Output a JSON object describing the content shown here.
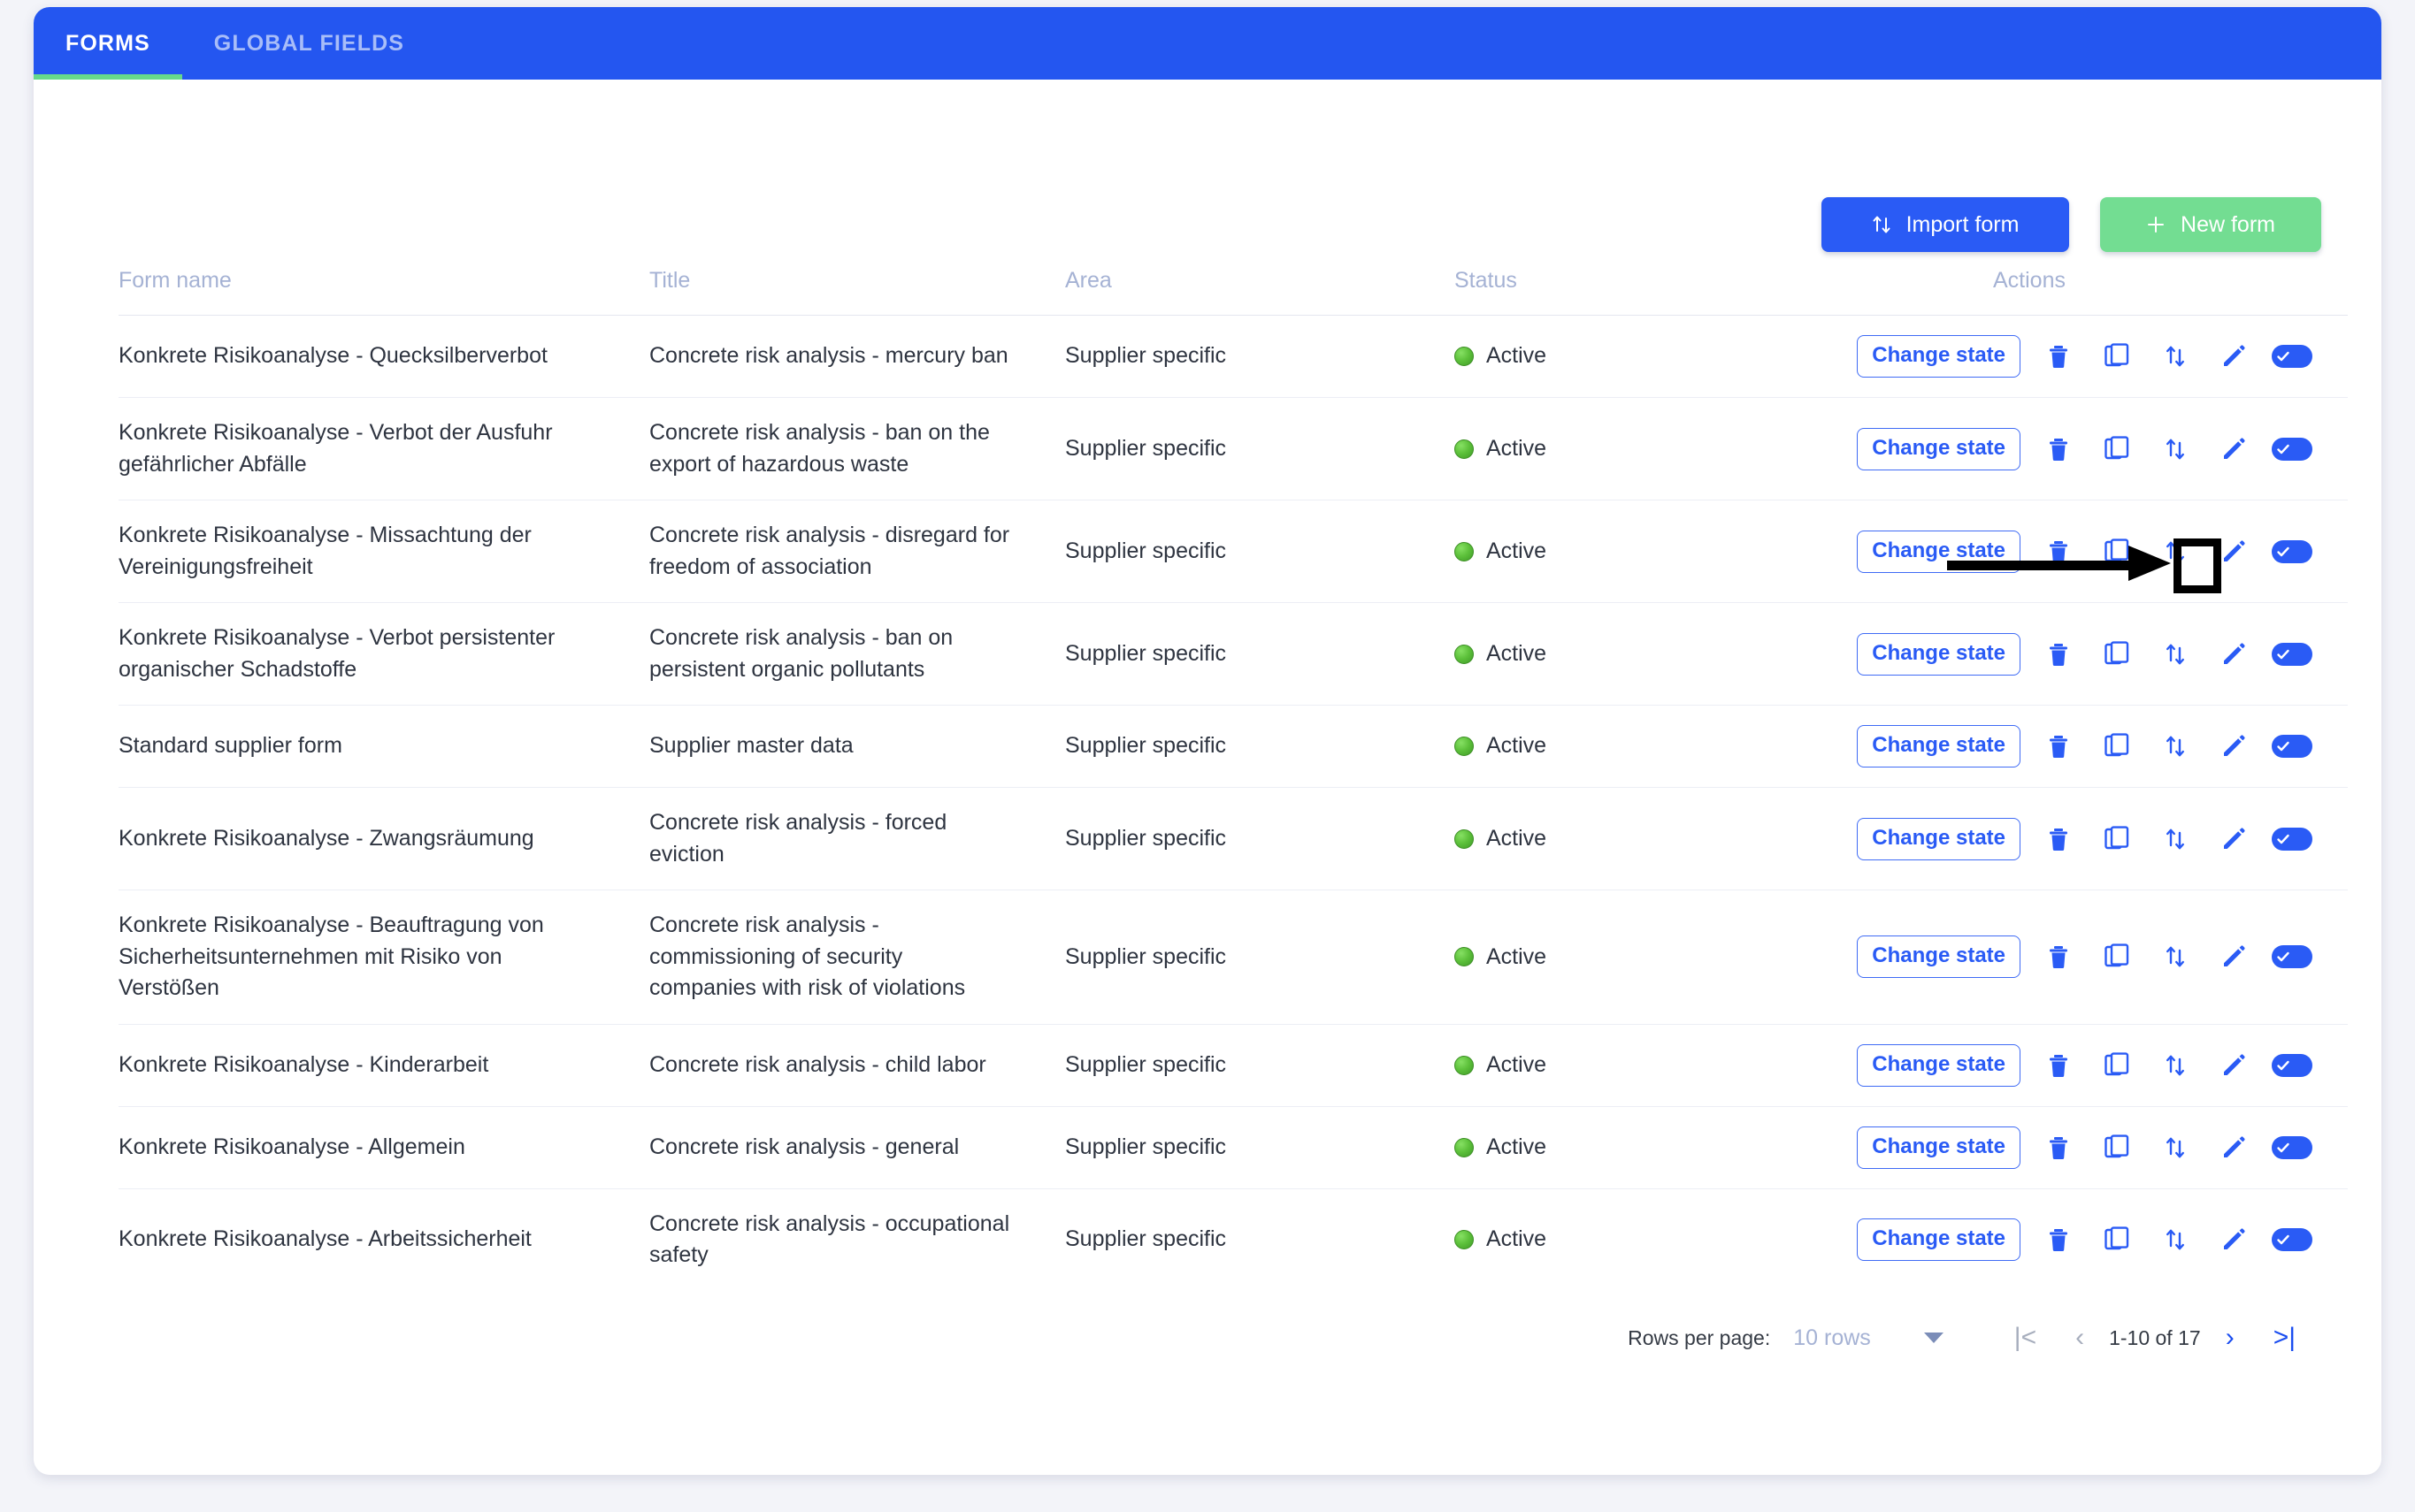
{
  "tabs": [
    {
      "label": "FORMS",
      "active": true
    },
    {
      "label": "GLOBAL FIELDS",
      "active": false
    }
  ],
  "toolbar": {
    "import_label": "Import form",
    "import_icon": "import-export-arrows-icon",
    "new_label": "New form",
    "new_icon": "plus-icon"
  },
  "table": {
    "headers": {
      "name": "Form name",
      "title": "Title",
      "area": "Area",
      "status": "Status",
      "actions": "Actions"
    },
    "row_action_labels": {
      "change_state": "Change state",
      "delete": "delete-icon",
      "duplicate": "copy-icon",
      "export": "import-export-arrows-icon",
      "edit": "pencil-icon",
      "toggle": "toggle-on-icon"
    },
    "rows": [
      {
        "name": "Konkrete Risikoanalyse - Quecksilberverbot",
        "title": "Concrete risk analysis - mercury ban",
        "area": "Supplier specific",
        "status": "Active"
      },
      {
        "name": "Konkrete Risikoanalyse - Verbot der Ausfuhr gefährlicher Abfälle",
        "title": "Concrete risk analysis - ban on the export of hazardous waste",
        "area": "Supplier specific",
        "status": "Active"
      },
      {
        "name": "Konkrete Risikoanalyse - Missachtung der Vereinigungsfreiheit",
        "title": "Concrete risk analysis - disregard for freedom of association",
        "area": "Supplier specific",
        "status": "Active"
      },
      {
        "name": "Konkrete Risikoanalyse - Verbot persistenter organischer Schadstoffe",
        "title": "Concrete risk analysis - ban on persistent organic pollutants",
        "area": "Supplier specific",
        "status": "Active"
      },
      {
        "name": "Standard supplier form",
        "title": "Supplier master data",
        "area": "Supplier specific",
        "status": "Active"
      },
      {
        "name": "Konkrete Risikoanalyse - Zwangsräumung",
        "title": "Concrete risk analysis - forced eviction",
        "area": "Supplier specific",
        "status": "Active"
      },
      {
        "name": "Konkrete Risikoanalyse - Beauftragung von Sicherheitsunternehmen mit Risiko von Verstößen",
        "title": "Concrete risk analysis - commissioning of security companies with risk of violations",
        "area": "Supplier specific",
        "status": "Active"
      },
      {
        "name": "Konkrete Risikoanalyse - Kinderarbeit",
        "title": "Concrete risk analysis - child labor",
        "area": "Supplier specific",
        "status": "Active"
      },
      {
        "name": "Konkrete Risikoanalyse - Allgemein",
        "title": "Concrete risk analysis - general",
        "area": "Supplier specific",
        "status": "Active"
      },
      {
        "name": "Konkrete Risikoanalyse - Arbeitssicherheit",
        "title": "Concrete risk analysis - occupational safety",
        "area": "Supplier specific",
        "status": "Active"
      }
    ]
  },
  "pagination": {
    "rows_per_page_label": "Rows per page:",
    "rows_per_page_value": "10 rows",
    "range": "1-10 of 17",
    "first_icon": "|<",
    "prev_icon": "‹",
    "next_icon": "›",
    "last_icon": ">|"
  },
  "annotation": {
    "target": "export-icon-row-3",
    "arrow_color": "#000000",
    "highlight_color": "#000000"
  },
  "colors": {
    "primary_blue": "#2456f0",
    "accent_green": "#73dd92",
    "tab_underline": "#67d98a",
    "status_green": "#5cc03a",
    "header_text": "#a5b2d4",
    "page_bg": "#f3f4f9"
  }
}
